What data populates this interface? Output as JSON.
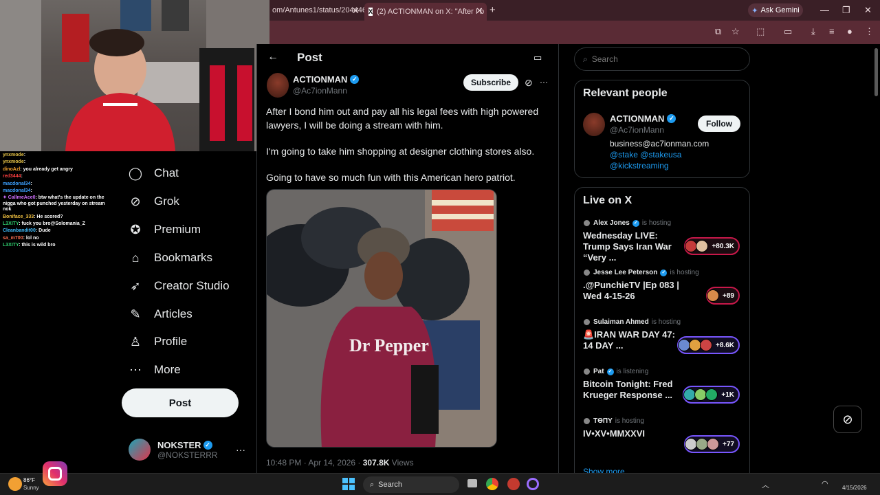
{
  "browser": {
    "tab1_title": "om/Antunes1/status/204446",
    "tab2_title": "(2) ACTIONMAN on X: \"After I b",
    "new_tab": "+",
    "gemini_label": "Ask Gemini",
    "window_controls": [
      "—",
      "❐",
      "✕"
    ]
  },
  "chat_messages": [
    {
      "user": "ynxmode",
      "text": "",
      "color": "#e8c547"
    },
    {
      "user": "ynxmode",
      "text": "",
      "color": "#e8c547"
    },
    {
      "user": "dinoAzl",
      "text": "you already get angry",
      "color": "#f0a030"
    },
    {
      "user": "red3444",
      "text": "",
      "color": "#ff4040"
    },
    {
      "user": "macdonal34",
      "text": "",
      "color": "#3ca0ff"
    },
    {
      "user": "macdonal34",
      "text": "",
      "color": "#3ca0ff"
    },
    {
      "user": "✦ CallmeAce0",
      "text": "btw what's the update on the nigga who got punched yesterday on stream nok",
      "color": "#d070ff"
    },
    {
      "user": "Boniface_333",
      "text": "He scored?",
      "color": "#f0c040"
    },
    {
      "user": "L3XITY",
      "text": "fuck you bro@Solomania_Z",
      "color": "#30d070"
    },
    {
      "user": "Cleanbandit00",
      "text": "Dude",
      "color": "#40c0ff"
    },
    {
      "user": "sa_m700",
      "text": "lol no",
      "color": "#ff7050"
    },
    {
      "user": "L3XITY",
      "text": "this is wild bro",
      "color": "#30d070"
    }
  ],
  "nav": {
    "items": [
      {
        "label": "Chat",
        "icon": "chat-icon"
      },
      {
        "label": "Grok",
        "icon": "grok-icon"
      },
      {
        "label": "Premium",
        "icon": "premium-icon"
      },
      {
        "label": "Bookmarks",
        "icon": "bookmark-icon"
      },
      {
        "label": "Creator Studio",
        "icon": "rocket-icon"
      },
      {
        "label": "Articles",
        "icon": "articles-icon"
      },
      {
        "label": "Profile",
        "icon": "profile-icon"
      },
      {
        "label": "More",
        "icon": "more-icon"
      }
    ],
    "post_button": "Post",
    "account_name": "NOKSTER",
    "account_handle": "@NOKSTERRR",
    "account_more": "···"
  },
  "post": {
    "header_title": "Post",
    "back": "←",
    "author_name": "ACTIONMAN",
    "author_handle": "@Ac7ionMann",
    "subscribe_label": "Subscribe",
    "more": "···",
    "paragraphs": [
      "After I bond him out and pay all his legal fees with high powered lawyers, I will be doing a stream with him.",
      "I'm going to take him shopping at designer clothing stores also.",
      "Going to have so much fun with this American hero patriot."
    ],
    "image_shirt_text": "Dr Pepper",
    "timestamp": "10:48 PM · Apr 14, 2026 · ",
    "views_count": "307.8K",
    "views_label": " Views"
  },
  "search": {
    "placeholder": "Search"
  },
  "relevant": {
    "title": "Relevant people",
    "name": "ACTIONMAN",
    "handle": "@Ac7ionMann",
    "follow_label": "Follow",
    "bio_line1": "business@ac7ionman.com",
    "bio_line2": "@stake @stakeusa",
    "bio_line3": "@kickstreaming"
  },
  "live": {
    "title": "Live on X",
    "items": [
      {
        "host": "Alex Jones",
        "status": "is hosting",
        "verified": true,
        "title": "Wednesday LIVE: Trump Says Iran War “Very ...",
        "count": "+80.3K",
        "style": "red"
      },
      {
        "host": "Jesse Lee Peterson",
        "status": "is hosting",
        "verified": true,
        "title": ".@PunchieTV |Ep 083 | Wed 4-15-26",
        "count": "+89",
        "style": "red"
      },
      {
        "host": "Sulaiman Ahmed",
        "status": "is hosting",
        "verified": false,
        "title": "🚨IRAN WAR DAY 47: 14 DAY ...",
        "count": "+8.6K",
        "style": "blue"
      },
      {
        "host": "Pat",
        "status": "is listening",
        "verified": true,
        "title": "Bitcoin Tonight:  Fred Krueger Response ...",
        "count": "+1K",
        "style": "blue"
      },
      {
        "host": "ТӨПY",
        "status": "is hosting",
        "verified": false,
        "title": "IV•XV•MMXXVI",
        "count": "+77",
        "style": "blue"
      }
    ],
    "show_more": "Show more"
  },
  "taskbar": {
    "weather_temp": "86°F",
    "weather_desc": "Sunny",
    "search_label": "Search",
    "date": "4/15/2026"
  },
  "colors": {
    "accent": "#1d9bf0",
    "browser_frame": "#3a1f26",
    "live_red": "#c9184a",
    "live_blue": "#7856ff"
  }
}
